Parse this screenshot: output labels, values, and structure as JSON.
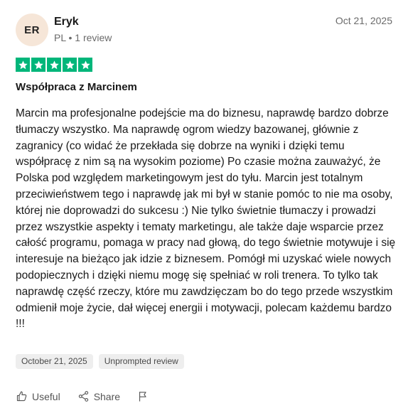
{
  "reviewer": {
    "initials": "ER",
    "name": "Eryk",
    "meta": "PL • 1 review",
    "avatar_bg": "#f6e6d8"
  },
  "review": {
    "date": "Oct 21, 2025",
    "rating": 5,
    "rating_max": 5,
    "star_color": "#00b67a",
    "title": "Współpraca z Marcinem",
    "body": "Marcin ma profesjonalne podejście ma do biznesu, naprawdę bardzo dobrze tłumaczy wszystko. Ma naprawdę ogrom wiedzy bazowanej, głównie z zagranicy (co widać że przekłada się dobrze na wyniki i dzięki temu współpracę z nim są na wysokim poziome) Po czasie można zauważyć, że Polska pod względem marketingowym jest do tyłu. Marcin jest totalnym przeciwieństwem tego i naprawdę jak mi był w stanie pomóc to nie ma osoby, której nie doprowadzi do sukcesu :) Nie tylko świetnie tłumaczy i prowadzi przez wszystkie aspekty i tematy marketingu, ale także daje wsparcie przez całość programu, pomaga w pracy nad głową, do tego świetnie motywuje i się interesuje na bieżąco jak idzie z biznesem. Pomógł mi uzyskać wiele nowych podopiecznych i dzięki niemu mogę się spełniać w roli trenera. To tylko tak naprawdę część rzeczy, które mu zawdzięczam bo do tego przede wszystkim odmienił moje życie, dał więcej energii i motywacji, polecam każdemu bardzo !!!",
    "tags": [
      "October 21, 2025",
      "Unprompted review"
    ]
  },
  "actions": {
    "useful_label": "Useful",
    "useful_icon": "thumbs-up-icon",
    "share_label": "Share",
    "share_icon": "share-icon",
    "report_icon": "flag-icon"
  }
}
